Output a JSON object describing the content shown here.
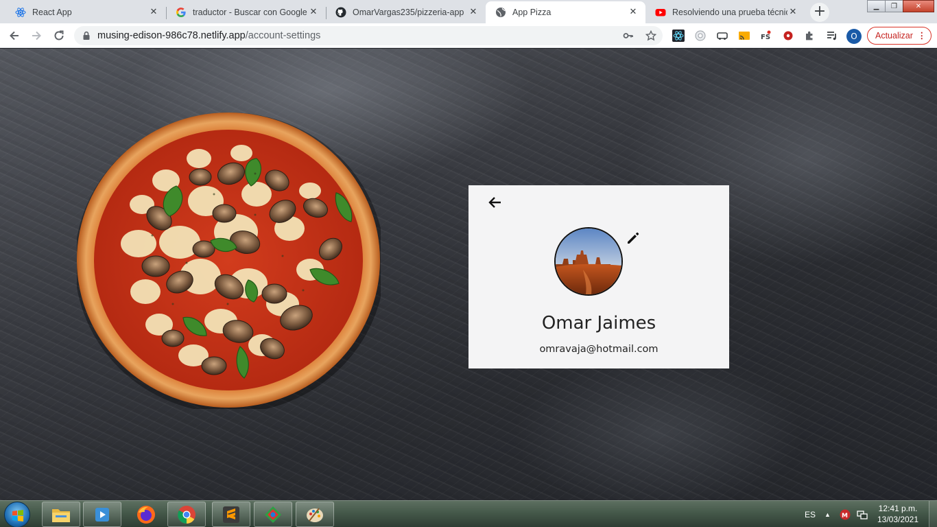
{
  "browser": {
    "tabs": [
      {
        "title": "React App",
        "icon": "react-icon",
        "active": false
      },
      {
        "title": "traductor - Buscar con Google",
        "icon": "google-icon",
        "active": false
      },
      {
        "title": "OmarVargas235/pizzeria-app",
        "icon": "github-icon",
        "active": false
      },
      {
        "title": "App Pizza",
        "icon": "globe-icon",
        "active": true
      },
      {
        "title": "Resolviendo una prueba técnica",
        "icon": "youtube-icon",
        "active": false
      }
    ],
    "url_host": "musing-edison-986c78.netlify.app",
    "url_path": "/account-settings",
    "profile_initial": "O",
    "update_label": "Actualizar"
  },
  "page": {
    "profile": {
      "name": "Omar Jaimes",
      "email": "omravaja@hotmail.com"
    }
  },
  "taskbar": {
    "language": "ES",
    "time": "12:41 p.m.",
    "date": "13/03/2021"
  },
  "colors": {
    "card_bg": "#f4f4f5",
    "accent_update": "#d93025",
    "profile_avatar": "#1a5aa7"
  }
}
